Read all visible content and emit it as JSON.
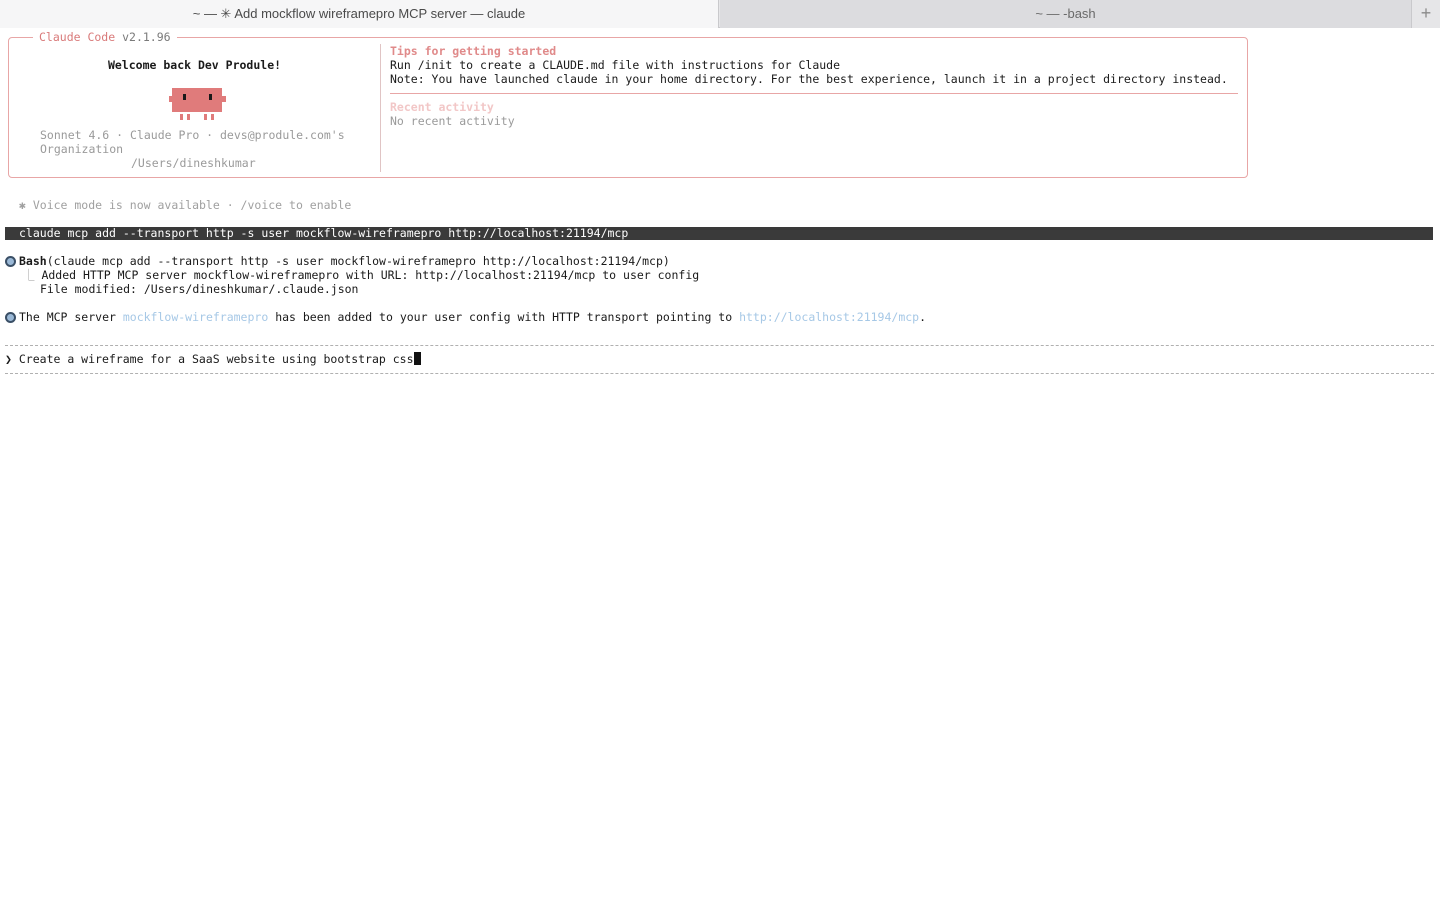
{
  "tabs": {
    "active_title": "~ — ✳ Add mockflow wireframepro MCP server — claude",
    "inactive_title": "~ — -bash",
    "add_label": "+"
  },
  "welcome": {
    "app_name": "Claude Code",
    "version": "v2.1.96",
    "greeting": "Welcome back Dev Produle!",
    "model_line": "Sonnet 4.6 · Claude Pro · devs@produle.com's",
    "org_line": "Organization",
    "cwd": "/Users/dineshkumar",
    "mascot_icon": "claude-mascot-icon"
  },
  "tips": {
    "title": "Tips for getting started",
    "line1": "Run /init to create a CLAUDE.md file with instructions for Claude",
    "line2": "Note: You have launched claude in your home directory. For the best experience, launch it in a project directory instead.",
    "recent_title": "Recent activity",
    "recent_empty": "No recent activity"
  },
  "notice": "✱ Voice mode is now available · /voice to enable",
  "command": "claude mcp add --transport http -s user mockflow-wireframepro http://localhost:21194/mcp",
  "tool_call": {
    "tool": "Bash",
    "args": "(claude mcp add --transport http -s user mockflow-wireframepro http://localhost:21194/mcp)",
    "tree_char": "⎿",
    "result1": "Added HTTP MCP server mockflow-wireframepro with URL: http://localhost:21194/mcp to user config",
    "result2": "File modified: /Users/dineshkumar/.claude.json"
  },
  "response": {
    "pre": "The MCP server ",
    "server": "mockflow-wireframepro",
    "mid": " has been added to your user config with HTTP transport pointing to ",
    "url": "http://localhost:21194/mcp",
    "post": "."
  },
  "prompt": {
    "arrow": "❯",
    "input": "Create a wireframe for a SaaS website using bootstrap css"
  },
  "colors": {
    "accent": "#d97a7a",
    "border": "#e8a6a6",
    "link": "#a6c8e6",
    "command_bg": "#3a3a3a"
  }
}
